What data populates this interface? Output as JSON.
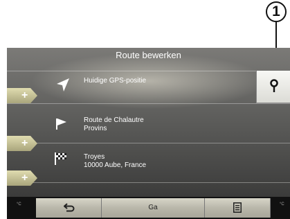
{
  "callout": {
    "number": "1"
  },
  "header": {
    "title": "Route bewerken"
  },
  "rows": [
    {
      "line1": "Huidige GPS-positie",
      "line2": "",
      "icon": "navigation-arrow-icon"
    },
    {
      "line1": "Route de Chalautre",
      "line2": "Provins",
      "icon": "flag-icon"
    },
    {
      "line1": "Troyes",
      "line2": "10000 Aube, France",
      "icon": "checkered-flag-icon"
    }
  ],
  "plus_buttons": [
    "+",
    "+",
    "+"
  ],
  "poi_button": {
    "icon": "location-pin-icon"
  },
  "bottom_bar": {
    "left_temp": "°C",
    "right_temp": "°C",
    "back_icon": "back-arrow-icon",
    "go_label": "Ga",
    "menu_icon": "menu-list-icon"
  },
  "colors": {
    "accent": "#d4cf9a",
    "screen_bg": "#4a4a48",
    "bar": "#111111"
  }
}
